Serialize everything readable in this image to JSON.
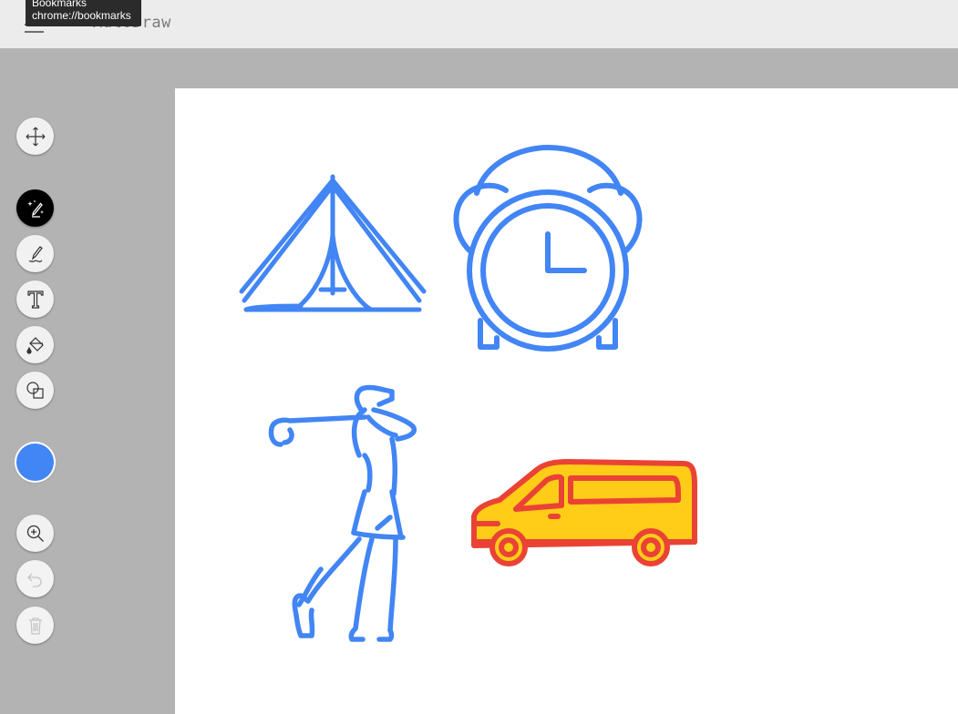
{
  "header": {
    "app_title": "AutoDraw",
    "tooltip": {
      "title": "Bookmarks",
      "url": "chrome://bookmarks"
    }
  },
  "toolbar": {
    "tools": [
      {
        "name": "move-tool",
        "icon": "move-arrows-icon",
        "state": "normal"
      },
      {
        "name": "autodraw-tool",
        "icon": "autodraw-sparkle-pencil-icon",
        "state": "active"
      },
      {
        "name": "draw-tool",
        "icon": "pencil-icon",
        "state": "normal"
      },
      {
        "name": "type-tool",
        "icon": "text-t-icon",
        "state": "normal"
      },
      {
        "name": "fill-tool",
        "icon": "paint-bucket-icon",
        "state": "normal"
      },
      {
        "name": "shape-tool",
        "icon": "shapes-icon",
        "state": "normal"
      },
      {
        "name": "zoom-tool",
        "icon": "zoom-in-icon",
        "state": "normal"
      },
      {
        "name": "undo-button",
        "icon": "undo-icon",
        "state": "disabled"
      },
      {
        "name": "delete-button",
        "icon": "trash-icon",
        "state": "disabled"
      }
    ],
    "current_color": "#4285f4"
  },
  "canvas": {
    "drawings": [
      {
        "name": "tent-drawing",
        "stroke": "#4285f4"
      },
      {
        "name": "alarm-clock-drawing",
        "stroke": "#4285f4"
      },
      {
        "name": "golfer-drawing",
        "stroke": "#4285f4"
      },
      {
        "name": "van-drawing",
        "stroke": "#ea4335",
        "fill": "#ffcc17"
      }
    ]
  }
}
